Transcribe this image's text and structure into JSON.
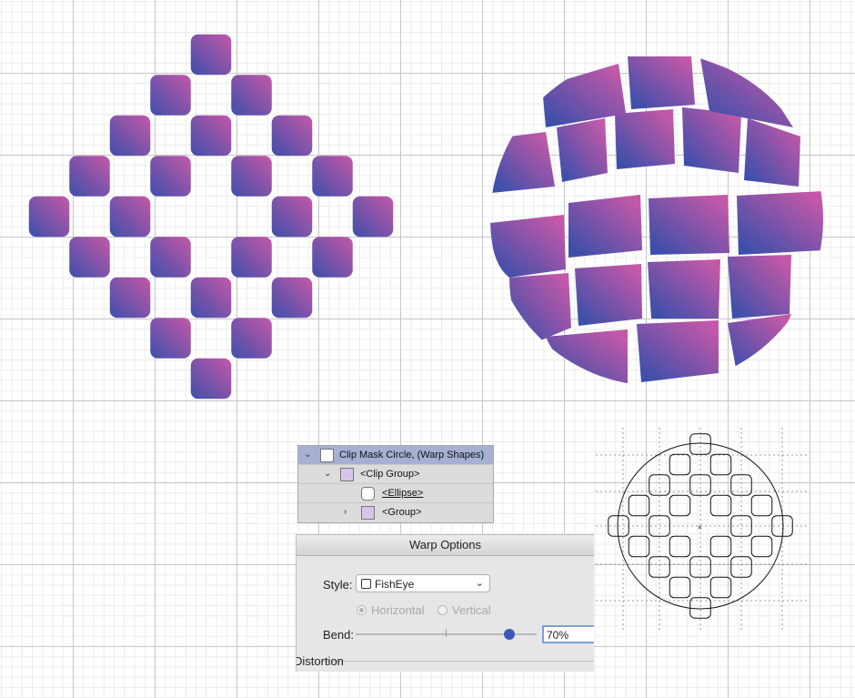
{
  "layers_panel": {
    "rows": [
      {
        "name": "Clip Mask Circle, (Warp Shapes)",
        "selected": true,
        "expanded": true
      },
      {
        "name": "<Clip Group>",
        "expanded": true
      },
      {
        "name": "<Ellipse>"
      },
      {
        "name": "<Group>",
        "expanded": false
      }
    ]
  },
  "warp_dialog": {
    "title": "Warp Options",
    "style_label": "Style:",
    "style_value": "FishEye",
    "orientation_options": [
      "Horizontal",
      "Vertical"
    ],
    "orientation_selected": "Horizontal",
    "orientation_enabled": false,
    "bend_label": "Bend:",
    "bend_value": "70%",
    "bend_percent": 70,
    "section_label": "Distortion"
  },
  "artwork": {
    "gradient_start": "#3d4faa",
    "gradient_end": "#c458a8",
    "outline_color": "#111111"
  }
}
